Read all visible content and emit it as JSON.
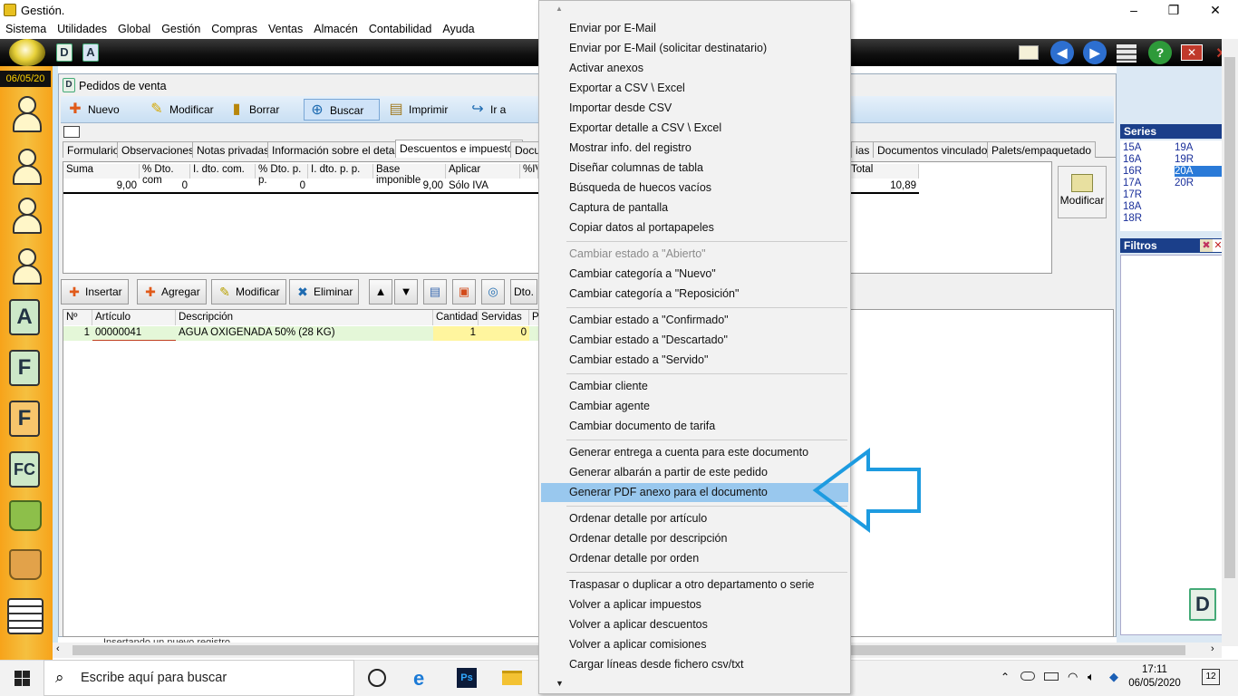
{
  "window": {
    "title": "Gestión.",
    "btn_min": "–",
    "btn_max": "❐",
    "btn_close": "✕"
  },
  "menubar": [
    "Sistema",
    "Utilidades",
    "Global",
    "Gestión",
    "Compras",
    "Ventas",
    "Almacén",
    "Contabilidad",
    "Ayuda"
  ],
  "blackbar": {
    "d_label": "D",
    "a_label": "A"
  },
  "sidebar": {
    "date": "06/05/20",
    "letters": [
      "A",
      "F",
      "F",
      "FC"
    ]
  },
  "doc": {
    "title": "Pedidos de venta",
    "toolbar": [
      "Nuevo",
      "Modificar",
      "Borrar",
      "Buscar",
      "Imprimir",
      "Ir a"
    ],
    "tabs": [
      "Formulario",
      "Observaciones",
      "Notas privadas",
      "Información sobre el detalle",
      "Descuentos e impuestos",
      "Docu",
      "ias",
      "Documentos vinculados",
      "Palets/empaquetado"
    ],
    "summary_headers": [
      "Suma",
      "% Dto. com",
      "I. dto. com.",
      "% Dto. p. p.",
      "I. dto. p. p.",
      "Base imponible",
      "Aplicar",
      "%IV",
      "Total"
    ],
    "summary_values": [
      "9,00",
      "0",
      "",
      "0",
      "",
      "9,00",
      "Sólo IVA",
      "",
      "10,89"
    ],
    "modify_label": "Modificar",
    "line_buttons": [
      "Insertar",
      "Agregar",
      "Modificar",
      "Eliminar"
    ],
    "dto_label": "Dto.",
    "detail_headers": [
      "Nº",
      "Artículo",
      "Descripción",
      "Cantidad",
      "Servidas",
      "Pe"
    ],
    "detail_row": [
      "1",
      "00000041",
      "AGUA OXIGENADA 50% (28 KG)",
      "1",
      "0"
    ],
    "status": "Insertando un nuevo registro"
  },
  "right": {
    "series_title": "Series",
    "series": [
      "15A",
      "16A",
      "16R",
      "17A",
      "17R",
      "18A",
      "18R",
      "19A",
      "19R",
      "20A",
      "20R"
    ],
    "selected_series": "20A",
    "filters_title": "Filtros",
    "doc_icon_label": "D"
  },
  "context_menu": {
    "scroll_up": "▲",
    "scroll_down": "▼",
    "highlighted": "Generar PDF anexo para el documento",
    "groups": [
      [
        "Enviar por E-Mail",
        "Enviar por E-Mail (solicitar destinatario)",
        "Activar anexos",
        "Exportar a CSV \\ Excel",
        "Importar desde CSV",
        "Exportar detalle a CSV \\ Excel",
        "Mostrar info. del registro",
        "Diseñar columnas de tabla",
        "Búsqueda de huecos vacíos",
        "Captura de pantalla",
        "Copiar datos al portapapeles"
      ],
      [
        "Cambiar estado a \"Abierto\"",
        "Cambiar categoría a \"Nuevo\"",
        "Cambiar categoría a \"Reposición\""
      ],
      [
        "Cambiar estado a \"Confirmado\"",
        "Cambiar estado a \"Descartado\"",
        "Cambiar estado a \"Servido\""
      ],
      [
        "Cambiar cliente",
        "Cambiar agente",
        "Cambiar documento de tarifa"
      ],
      [
        "Generar entrega a cuenta para este documento",
        "Generar albarán a partir de este pedido",
        "Generar PDF anexo para el documento"
      ],
      [
        "Ordenar detalle por artículo",
        "Ordenar detalle por descripción",
        "Ordenar detalle por orden"
      ],
      [
        "Traspasar  o duplicar a otro departamento o serie",
        "Volver a aplicar impuestos",
        "Volver a aplicar descuentos",
        "Volver a aplicar comisiones",
        "Cargar líneas desde fichero csv/txt"
      ]
    ]
  },
  "taskbar": {
    "search_placeholder": "Escribe aquí para buscar",
    "time": "17:11",
    "date": "06/05/2020",
    "notif_count": "12"
  },
  "colors": {
    "accent_blue": "#1b3f8a",
    "highlight": "#99c8ee",
    "sidebar_orange": "#f7a31a",
    "arrow": "#1d9be0"
  }
}
